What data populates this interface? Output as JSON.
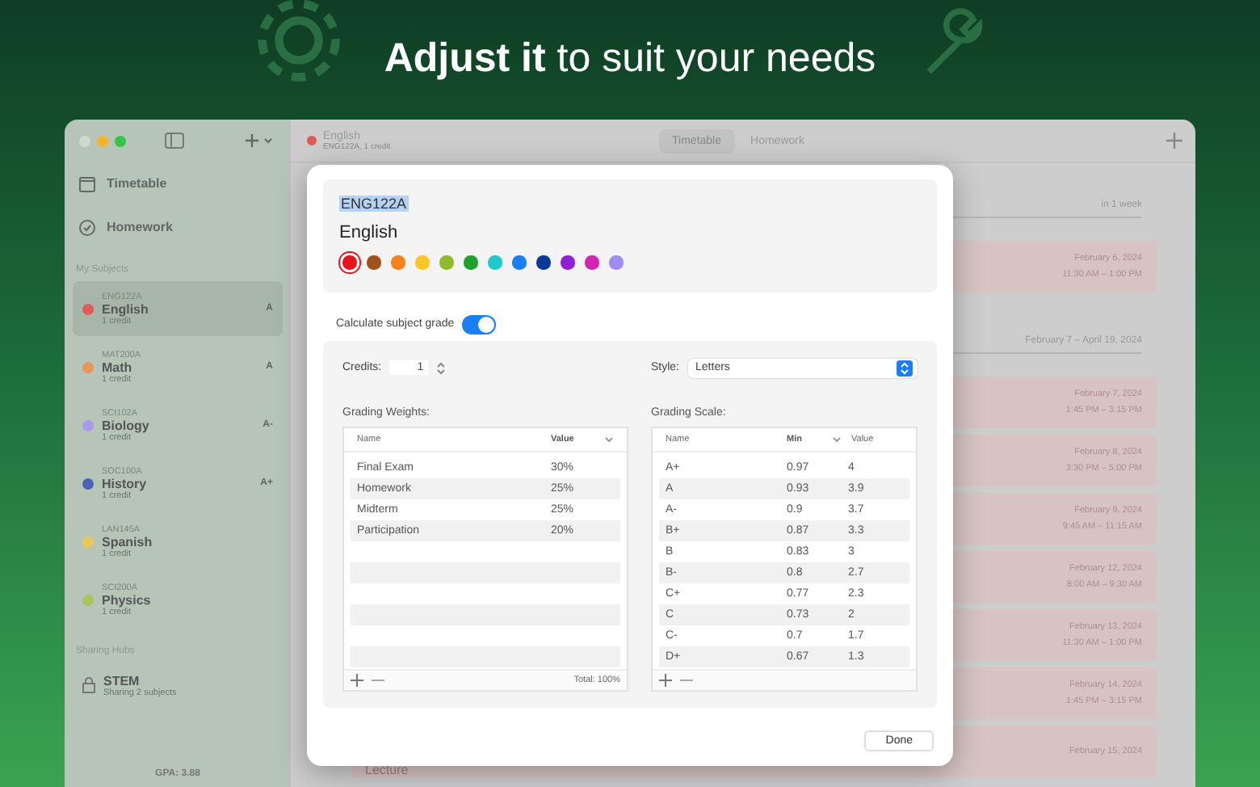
{
  "headline": "**Adjust it** to suit your needs",
  "sidebar": {
    "nav": [
      {
        "label": "Timetable",
        "kind": "calendar"
      },
      {
        "label": "Homework",
        "kind": "check"
      }
    ],
    "subjects_header": "My Subjects",
    "subjects": [
      {
        "code": "ENG122A",
        "name": "English",
        "credits": "1 credit",
        "grade": "A",
        "color": "#e05a5a",
        "selected": true
      },
      {
        "code": "MAT200A",
        "name": "Math",
        "credits": "1 credit",
        "grade": "A",
        "color": "#e8965a",
        "selected": false
      },
      {
        "code": "SCI102A",
        "name": "Biology",
        "credits": "1 credit",
        "grade": "A-",
        "color": "#a89be8",
        "selected": false
      },
      {
        "code": "SOC100A",
        "name": "History",
        "credits": "1 credit",
        "grade": "A+",
        "color": "#4a62b8",
        "selected": false
      },
      {
        "code": "LAN145A",
        "name": "Spanish",
        "credits": "1 credit",
        "color": "#e8c85a",
        "selected": false
      },
      {
        "code": "SCI200A",
        "name": "Physics",
        "credits": "1 credit",
        "color": "#a8c45a",
        "selected": false
      }
    ],
    "hubs_header": "Sharing Hubs",
    "hubs": [
      {
        "name": "STEM",
        "detail": "Sharing 2 subjects"
      }
    ],
    "gpa": "GPA: 3.88"
  },
  "toolbar": {
    "subject": {
      "name": "English",
      "detail": "ENG122A, 1 credit",
      "color": "#e05a5a"
    },
    "tabs": [
      {
        "label": "Timetable",
        "selected": true
      },
      {
        "label": "Homework",
        "selected": false
      }
    ]
  },
  "timetable": {
    "sections": [
      {
        "header": "in 1 week",
        "events": [
          {
            "date": "February 6, 2024",
            "time": "11:30 AM – 1:00 PM"
          }
        ]
      },
      {
        "header": "February 7 – April 19, 2024",
        "events": [
          {
            "date": "February 7, 2024",
            "time": "1:45 PM – 3:15 PM"
          },
          {
            "date": "February 8, 2024",
            "time": "3:30 PM – 5:00 PM"
          },
          {
            "date": "February 9, 2024",
            "time": "9:45 AM – 11:15 AM"
          },
          {
            "date": "February 12, 2024",
            "time": "8:00 AM – 9:30 AM"
          },
          {
            "date": "February 13, 2024",
            "time": "11:30 AM – 1:00 PM"
          },
          {
            "date": "February 14, 2024",
            "time": "1:45 PM – 3:15 PM"
          },
          {
            "title": "Lecture",
            "date": "February 15, 2024"
          }
        ]
      }
    ]
  },
  "dialog": {
    "code": "ENG122A",
    "name": "English",
    "colors": [
      {
        "color": "#e8141b",
        "selected": true
      },
      {
        "color": "#a0521e",
        "selected": false
      },
      {
        "color": "#f7821b",
        "selected": false
      },
      {
        "color": "#fcc626",
        "selected": false
      },
      {
        "color": "#8dbb2c",
        "selected": false
      },
      {
        "color": "#1fa12e",
        "selected": false
      },
      {
        "color": "#21c8cc",
        "selected": false
      },
      {
        "color": "#1a7ef5",
        "selected": false
      },
      {
        "color": "#0a3a97",
        "selected": false
      },
      {
        "color": "#8e21d6",
        "selected": false
      },
      {
        "color": "#d424b0",
        "selected": false
      },
      {
        "color": "#a08cf6",
        "selected": false
      }
    ],
    "calculate_label": "Calculate subject grade",
    "calculate_on": true,
    "credits_label": "Credits:",
    "credits": "1",
    "style_label": "Style:",
    "style": "Letters",
    "weights": {
      "title": "Grading Weights:",
      "columns": [
        "Name",
        "Value"
      ],
      "rows": [
        [
          "Final Exam",
          "30%"
        ],
        [
          "Homework",
          "25%"
        ],
        [
          "Midterm",
          "25%"
        ],
        [
          "Participation",
          "20%"
        ]
      ],
      "total": "Total: 100%"
    },
    "scale": {
      "title": "Grading Scale:",
      "columns": [
        "Name",
        "Min",
        "Value"
      ],
      "rows": [
        [
          "A+",
          "0.97",
          "4"
        ],
        [
          "A",
          "0.93",
          "3.9"
        ],
        [
          "A-",
          "0.9",
          "3.7"
        ],
        [
          "B+",
          "0.87",
          "3.3"
        ],
        [
          "B",
          "0.83",
          "3"
        ],
        [
          "B-",
          "0.8",
          "2.7"
        ],
        [
          "C+",
          "0.77",
          "2.3"
        ],
        [
          "C",
          "0.73",
          "2"
        ],
        [
          "C-",
          "0.7",
          "1.7"
        ],
        [
          "D+",
          "0.67",
          "1.3"
        ]
      ]
    },
    "done": "Done"
  }
}
